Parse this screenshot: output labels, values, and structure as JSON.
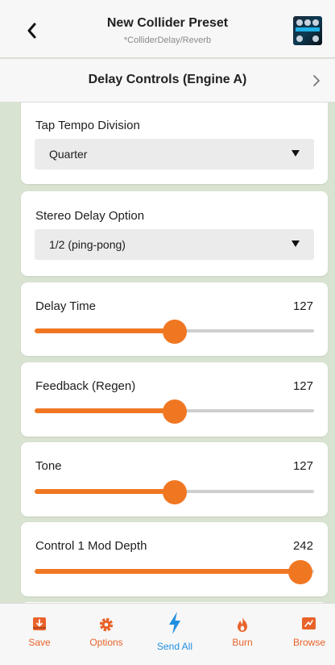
{
  "header": {
    "title": "New Collider Preset",
    "subtitle": "*ColliderDelay/Reverb"
  },
  "section": {
    "title": "Delay Controls (Engine A)"
  },
  "controls": {
    "tap_tempo": {
      "label": "Tap Tempo Division",
      "value": "Quarter"
    },
    "stereo_delay": {
      "label": "Stereo Delay Option",
      "value": "1/2 (ping-pong)"
    },
    "delay_time": {
      "label": "Delay Time",
      "value": "127",
      "level": 0.5
    },
    "feedback": {
      "label": "Feedback (Regen)",
      "value": "127",
      "level": 0.5
    },
    "tone": {
      "label": "Tone",
      "value": "127",
      "level": 0.5
    },
    "mod_depth": {
      "label": "Control 1 Mod Depth",
      "value": "242",
      "level": 0.95
    }
  },
  "toolbar": {
    "save": "Save",
    "options": "Options",
    "send_all": "Send All",
    "burn": "Burn",
    "browse": "Browse"
  },
  "colors": {
    "accent": "#f07722",
    "toolbar_orange": "#e8622a",
    "toolbar_blue": "#1e8fe0",
    "background": "#d9e3d2"
  }
}
